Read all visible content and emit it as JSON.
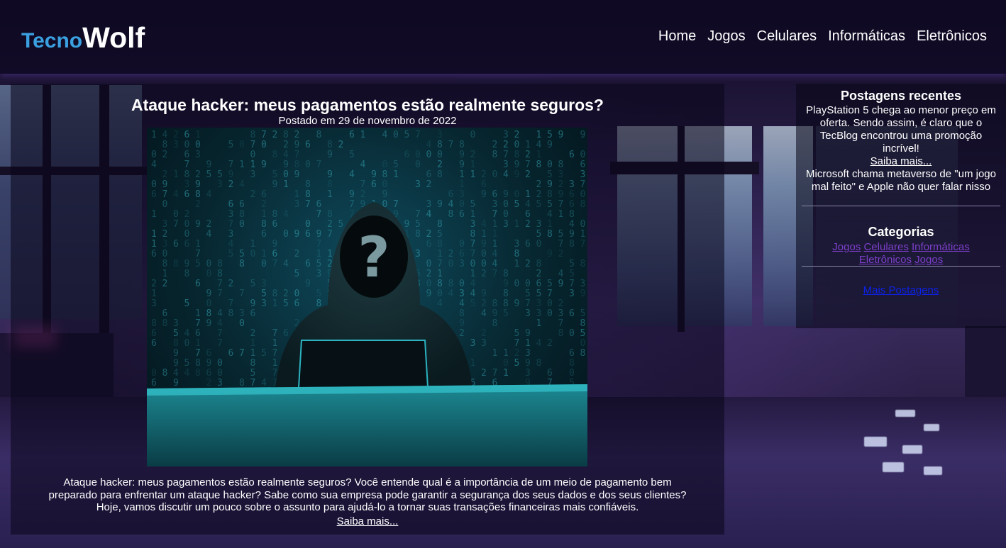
{
  "brand": {
    "part1": "Tecno",
    "part2": "Wolf"
  },
  "nav": [
    {
      "label": "Home"
    },
    {
      "label": "Jogos"
    },
    {
      "label": "Celulares"
    },
    {
      "label": "Informáticas"
    },
    {
      "label": "Eletrônicos"
    }
  ],
  "article": {
    "title": "Ataque hacker: meus pagamentos estão realmente seguros?",
    "date": "Postado em 29 de novembro de 2022",
    "excerpt_lines": [
      "Ataque hacker: meus pagamentos estão realmente seguros? Você entende qual é a importância de um meio de pagamento bem",
      "preparado para enfrentar um ataque hacker? Sabe como sua empresa pode garantir a segurança dos seus dados e dos seus clientes?",
      "Hoje, vamos discutir um pouco sobre o assunto para ajudá-lo a tornar suas transações financeiras mais confiáveis."
    ],
    "read_more": "Saiba mais..."
  },
  "sidebar": {
    "recent": {
      "heading": "Postagens recentes",
      "post1_text": "PlayStation 5 chega ao menor preço em oferta. Sendo assim, é claro que o TecBlog encontrou uma promoção incrível!",
      "post1_more": "Saiba mais...",
      "post2_text": "Microsoft chama metaverso de \"um jogo mal feito\" e Apple não quer falar nisso"
    },
    "categories": {
      "heading": "Categorias",
      "line1": [
        "Jogos",
        "Celulares",
        "Informáticas"
      ],
      "line2": [
        "Eletrônicos",
        "Jogos"
      ]
    },
    "more_posts": "Mais Postagens"
  }
}
